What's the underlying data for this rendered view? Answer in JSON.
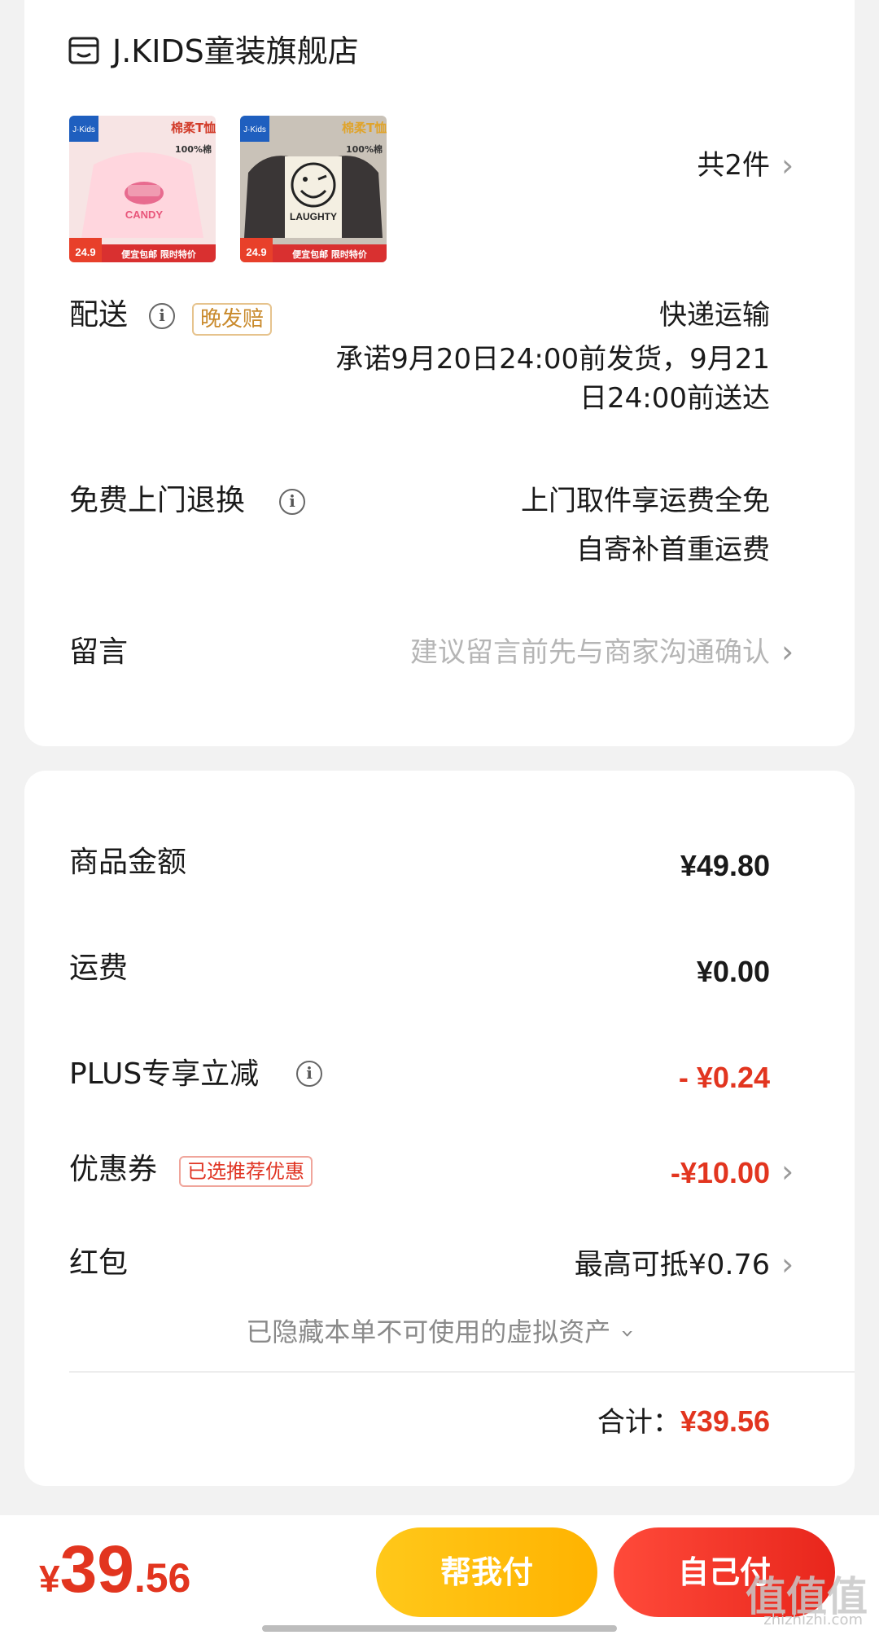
{
  "store": {
    "name": "J.KIDS童装旗舰店",
    "icon": "store-icon",
    "item_count": "共2件",
    "thumbs": [
      {
        "brand": "J·Kids",
        "title": "棉柔T恤",
        "badge": "100%棉",
        "graphic_text": "CANDY",
        "price": "24.9",
        "promo": "便宜包邮 限时特价"
      },
      {
        "brand": "J·Kids",
        "title": "棉柔T恤",
        "badge": "100%棉",
        "graphic_text": "LAUGHTY",
        "price": "24.9",
        "promo": "便宜包邮 限时特价"
      }
    ]
  },
  "delivery": {
    "label": "配送",
    "tag": "晚发赔",
    "method": "快递运输",
    "promise_line1": "承诺9月20日24:00前发货，9月21",
    "promise_line2": "日24:00前送达"
  },
  "returns": {
    "label": "免费上门退换",
    "line1": "上门取件享运费全免",
    "line2": "自寄补首重运费"
  },
  "message": {
    "label": "留言",
    "placeholder": "建议留言前先与商家沟通确认"
  },
  "summary": {
    "goods_label": "商品金额",
    "goods_value": "¥49.80",
    "shipping_label": "运费",
    "shipping_value": "¥0.00",
    "plus_label": "PLUS专享立减",
    "plus_value": "- ¥0.24",
    "coupon_label": "优惠券",
    "coupon_tag": "已选推荐优惠",
    "coupon_value": "-¥10.00",
    "redpacket_label": "红包",
    "redpacket_value": "最高可抵¥0.76",
    "hidden_assets": "已隐藏本单不可使用的虚拟资产",
    "total_label": "合计：",
    "total_value": "¥39.56"
  },
  "bottom": {
    "currency": "¥",
    "total_int": "39",
    "total_dec": ".56",
    "help_pay": "帮我付",
    "self_pay": "自己付",
    "watermark": "值值值",
    "watermark_sub": "zhizhizhi.com"
  },
  "colors": {
    "accent_red": "#e2351f",
    "help_pay_yellow": "#ffc81a",
    "late_tag_gold": "#c98a2c"
  }
}
